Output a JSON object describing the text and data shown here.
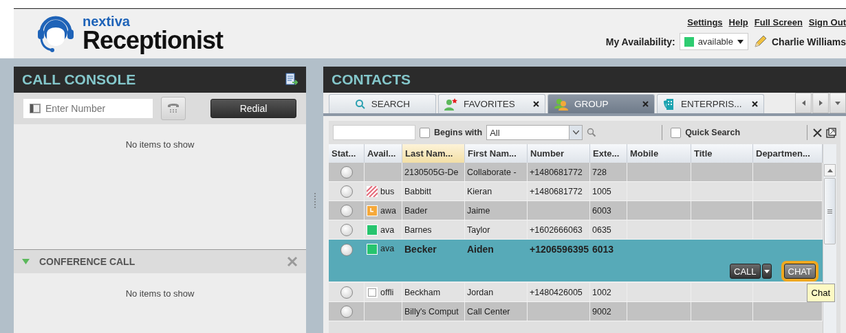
{
  "header": {
    "brand_small": "nextiva",
    "brand_large": "Receptionist",
    "links": [
      "Settings",
      "Help",
      "Full Screen",
      "Sign Out"
    ],
    "availability_label": "My Availability:",
    "availability": {
      "value": "available",
      "color": "#2ecc71"
    },
    "user": "Charlie Williams"
  },
  "call_console": {
    "title": "CALL CONSOLE",
    "number_field": {
      "placeholder": "Enter Number"
    },
    "redial": "Redial",
    "empty": "No items to show",
    "conference": {
      "title": "CONFERENCE CALL",
      "expanded": true,
      "empty": "No items to show"
    }
  },
  "contacts": {
    "title": "CONTACTS",
    "tabs": [
      {
        "label": "SEARCH",
        "kind": "search",
        "closable": false,
        "selected": false
      },
      {
        "label": "FAVORITES",
        "kind": "favorites",
        "closable": true,
        "selected": false
      },
      {
        "label": "GROUP",
        "kind": "group",
        "closable": true,
        "selected": true
      },
      {
        "label": "ENTERPRIS...",
        "kind": "enterprise",
        "closable": true,
        "selected": false
      }
    ],
    "filter": {
      "begins_with": {
        "label": "Begins with",
        "checked": false
      },
      "dropdown": "All",
      "quick_search": {
        "label": "Quick Search",
        "checked": false
      }
    },
    "columns": [
      {
        "label": "Stat...",
        "sorted": false
      },
      {
        "label": "Avail...",
        "sorted": false
      },
      {
        "label": "Last Nam...",
        "sorted": true
      },
      {
        "label": "First Nam...",
        "sorted": false
      },
      {
        "label": "Number",
        "sorted": false
      },
      {
        "label": "Exte...",
        "sorted": false
      },
      {
        "label": "Mobile",
        "sorted": false
      },
      {
        "label": "Title",
        "sorted": false
      },
      {
        "label": "Departmen...",
        "sorted": false
      }
    ],
    "rows": [
      {
        "selected": false,
        "availability": {
          "kind": "none"
        },
        "last": "2130505G-De",
        "first": "Collaborate -",
        "number": "+1480681772",
        "ext": "728"
      },
      {
        "selected": false,
        "availability": {
          "kind": "busy",
          "label": "bus"
        },
        "last": "Babbitt",
        "first": "Kieran",
        "number": "+1480681772",
        "ext": "1005"
      },
      {
        "selected": false,
        "availability": {
          "kind": "away",
          "label": "awa"
        },
        "last": "Bader",
        "first": "Jaime",
        "ext": "6003"
      },
      {
        "selected": false,
        "availability": {
          "kind": "available",
          "label": "ava"
        },
        "last": "Barnes",
        "first": "Taylor",
        "number": "+1602666063",
        "ext": "0635"
      },
      {
        "selected": true,
        "availability": {
          "kind": "available",
          "label": "ava"
        },
        "last": "Becker",
        "first": "Aiden",
        "number": "+1206596395",
        "ext": "6013",
        "actions": [
          {
            "label": "CALL",
            "kind": "split",
            "highlighted": false
          },
          {
            "label": "CHAT",
            "kind": "plain",
            "highlighted": true
          }
        ],
        "tooltip": "Chat"
      },
      {
        "selected": false,
        "availability": {
          "kind": "offline",
          "label": "offli"
        },
        "last": "Beckham",
        "first": "Jordan",
        "number": "+1480426005",
        "ext": "1002"
      },
      {
        "selected": false,
        "availability": {
          "kind": "none"
        },
        "last": "Billy's Comput",
        "first": "Call Center",
        "ext": "9002"
      }
    ]
  }
}
